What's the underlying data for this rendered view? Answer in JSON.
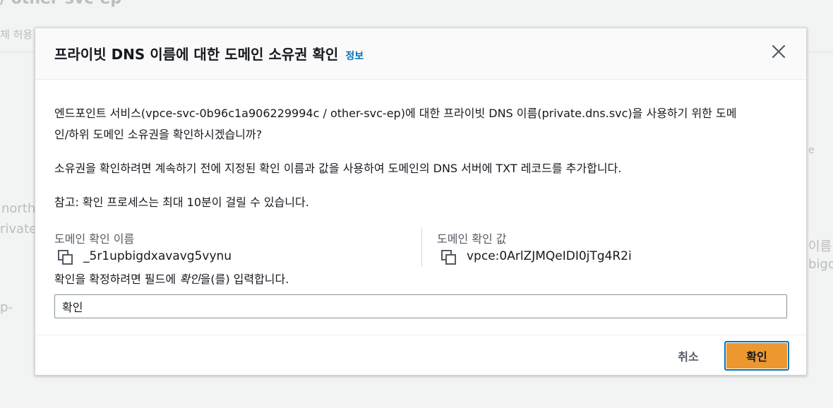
{
  "background": {
    "header_fragment": "/ other-svc-ep",
    "tab_fragment": "체 허용",
    "left_fragments": [
      "north",
      "rivate",
      "p-"
    ],
    "right_fragments": [
      "이름",
      "bigd",
      "e"
    ]
  },
  "modal": {
    "title": "프라이빗 DNS 이름에 대한 도메인 소유권 확인",
    "info_link": "정보",
    "paragraph1_line1": "엔드포인트 서비스(vpce-svc-0b96c1a906229994c / other-svc-ep)에 대한 프라이빗 DNS 이름(private.dns.svc)을 사용하기 위한 도메",
    "paragraph1_line2": "인/하위 도메인 소유권을 확인하시겠습니까?",
    "paragraph2": "소유권을 확인하려면 계속하기 전에 지정된 확인 이름과 값을 사용하여 도메인의 DNS 서버에 TXT 레코드를 추가합니다.",
    "paragraph3": "참고: 확인 프로세스는 최대 10분이 걸릴 수 있습니다.",
    "verification_name_label": "도메인 확인 이름",
    "verification_name_value": "_5r1upbigdxavavg5vynu",
    "verification_value_label": "도메인 확인 값",
    "verification_value_value": "vpce:0ArlZJMQeIDI0jTg4R2i",
    "confirm_prompt_prefix": "확인을 확정하려면 필드에 ",
    "confirm_prompt_keyword": "확인",
    "confirm_prompt_suffix": "을(를) 입력합니다.",
    "input_value": "확인",
    "cancel_label": "취소",
    "confirm_label": "확인"
  },
  "colors": {
    "accent": "#ec972f",
    "link": "#0073bb",
    "focus_ring": "#0073bb"
  },
  "icons": {
    "close": "close-icon",
    "copy": "copy-icon"
  }
}
